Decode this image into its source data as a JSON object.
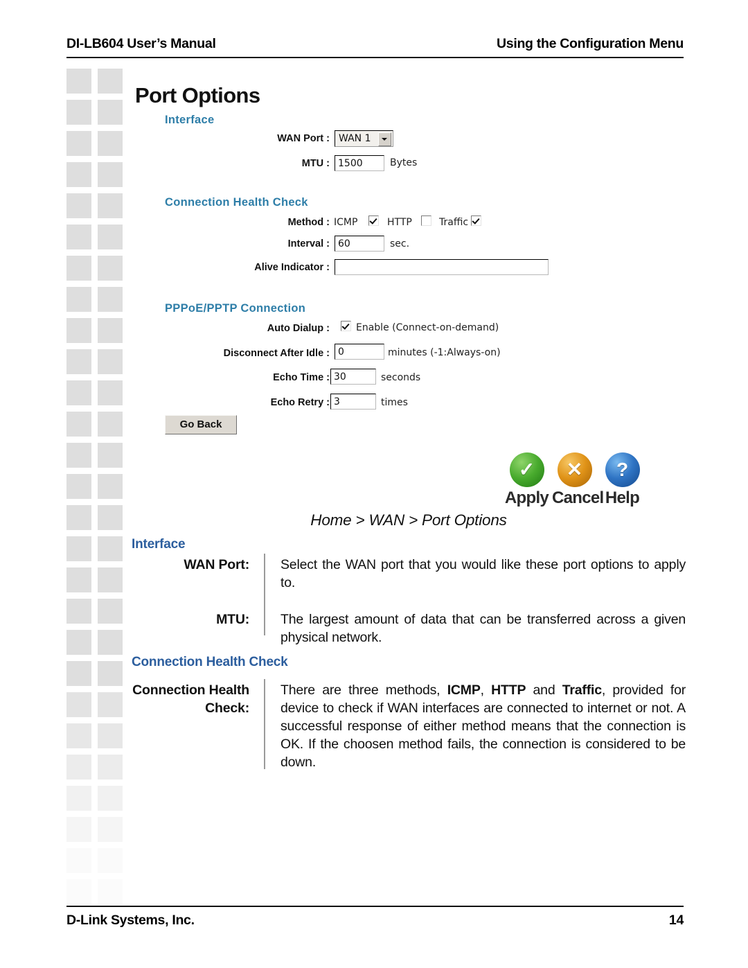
{
  "header": {
    "left": "DI-LB604 User’s Manual",
    "right": "Using the Configuration Menu"
  },
  "footer": {
    "company": "D-Link Systems, Inc.",
    "page_number": "14"
  },
  "ui": {
    "title": "Port Options",
    "colors": {
      "section_heading": "#2E7EA8",
      "doc_heading": "#2C5E9E",
      "apply_green": "#49AB2E",
      "cancel_orange": "#E09318",
      "help_blue": "#2F74C4"
    },
    "interface": {
      "heading": "Interface",
      "wan_port_label": "WAN Port :",
      "wan_port_value": "WAN 1",
      "mtu_label": "MTU :",
      "mtu_value": "1500",
      "mtu_unit": "Bytes"
    },
    "health_check": {
      "heading": "Connection Health Check",
      "method_label": "Method :",
      "methods": [
        {
          "name": "ICMP",
          "checked": true
        },
        {
          "name": "HTTP",
          "checked": false
        },
        {
          "name": "Traffic",
          "checked": true
        }
      ],
      "interval_label": "Interval :",
      "interval_value": "60",
      "interval_unit": "sec.",
      "alive_indicator_label": "Alive Indicator :",
      "alive_indicator_value": ""
    },
    "pppoe": {
      "heading": "PPPoE/PPTP Connection",
      "auto_dialup_label": "Auto Dialup :",
      "auto_dialup_checked": true,
      "auto_dialup_text": "Enable (Connect-on-demand)",
      "disconnect_label": "Disconnect After Idle :",
      "disconnect_value": "0",
      "disconnect_unit": "minutes (-1:Always-on)",
      "echo_time_label": "Echo Time :",
      "echo_time_value": "30",
      "echo_time_unit": "seconds",
      "echo_retry_label": "Echo Retry :",
      "echo_retry_value": "3",
      "echo_retry_unit": "times"
    },
    "go_back_label": "Go Back",
    "actions": [
      {
        "glyph": "✓",
        "label": "Apply"
      },
      {
        "glyph": "✕",
        "label": "Cancel"
      },
      {
        "glyph": "?",
        "label": "Help"
      }
    ]
  },
  "breadcrumb": "Home > WAN > Port Options",
  "docs": {
    "interface_heading": "Interface",
    "wan_port_term": "WAN Port:",
    "wan_port_desc": "Select the WAN port that you would like these port options to apply to.",
    "mtu_term": "MTU:",
    "mtu_desc": "The largest amount of data that can be transferred across a given physical network.",
    "health_heading": "Connection Health Check",
    "health_term": "Connection Health Check:",
    "health_desc_pre": "There are three methods, ",
    "health_desc_b1": "ICMP",
    "health_desc_mid1": ", ",
    "health_desc_b2": "HTTP",
    "health_desc_mid2": " and ",
    "health_desc_b3": "Traffic",
    "health_desc_post": ", provided for device to check if WAN interfaces are connected to internet or not. A successful response of either method means that the connection is OK. If the choosen method fails, the connection is considered to be down."
  }
}
